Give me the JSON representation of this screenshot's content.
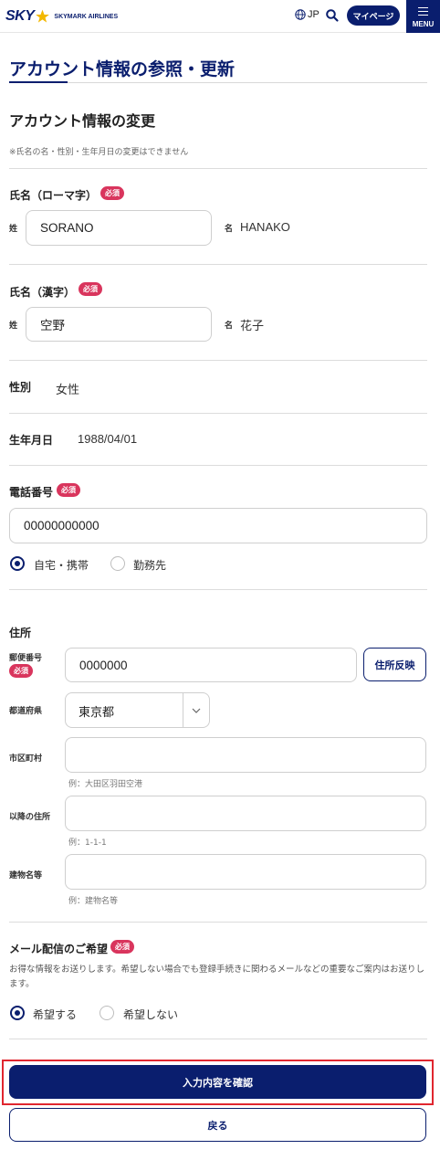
{
  "header": {
    "logo_main": "SKY",
    "logo_sub": "SKYMARK AIRLINES",
    "language": "JP",
    "mypage_label": "マイページ",
    "menu_label": "MENU",
    "brand_color": "#0a1e6e"
  },
  "page": {
    "title": "アカウント情報の参照・更新",
    "section_title": "アカウント情報の変更",
    "note": "※氏名の名・性別・生年月日の変更はできません"
  },
  "required_badge": "必須",
  "name_roman": {
    "label": "氏名（ローマ字）",
    "family_label": "姓",
    "family_value": "SORANO",
    "given_label": "名",
    "given_value": "HANAKO"
  },
  "name_kanji": {
    "label": "氏名（漢字）",
    "family_label": "姓",
    "family_value": "空野",
    "given_label": "名",
    "given_value": "花子"
  },
  "gender": {
    "label": "性別",
    "value": "女性"
  },
  "birthdate": {
    "label": "生年月日",
    "value": "1988/04/01"
  },
  "phone": {
    "label": "電話番号",
    "value": "00000000000",
    "options": [
      "自宅・携帯",
      "勤務先"
    ],
    "selected": "自宅・携帯"
  },
  "address": {
    "label": "住所",
    "postal_label": "郵便番号",
    "postal_value": "0000000",
    "reflect_button": "住所反映",
    "prefecture_label": "都道府県",
    "prefecture_value": "東京都",
    "city_label": "市区町村",
    "city_value": "",
    "city_hint": "例：大田区羽田空港",
    "street_label": "以降の住所",
    "street_value": "",
    "street_hint": "例：1-1-1",
    "building_label": "建物名等",
    "building_value": "",
    "building_hint": "例：建物名等"
  },
  "mail": {
    "label": "メール配信のご希望",
    "description": "お得な情報をお送りします。希望しない場合でも登録手続きに関わるメールなどの重要なご案内はお送りします。",
    "options": [
      "希望する",
      "希望しない"
    ],
    "selected": "希望する"
  },
  "actions": {
    "confirm_label": "入力内容を確認",
    "back_label": "戻る"
  }
}
